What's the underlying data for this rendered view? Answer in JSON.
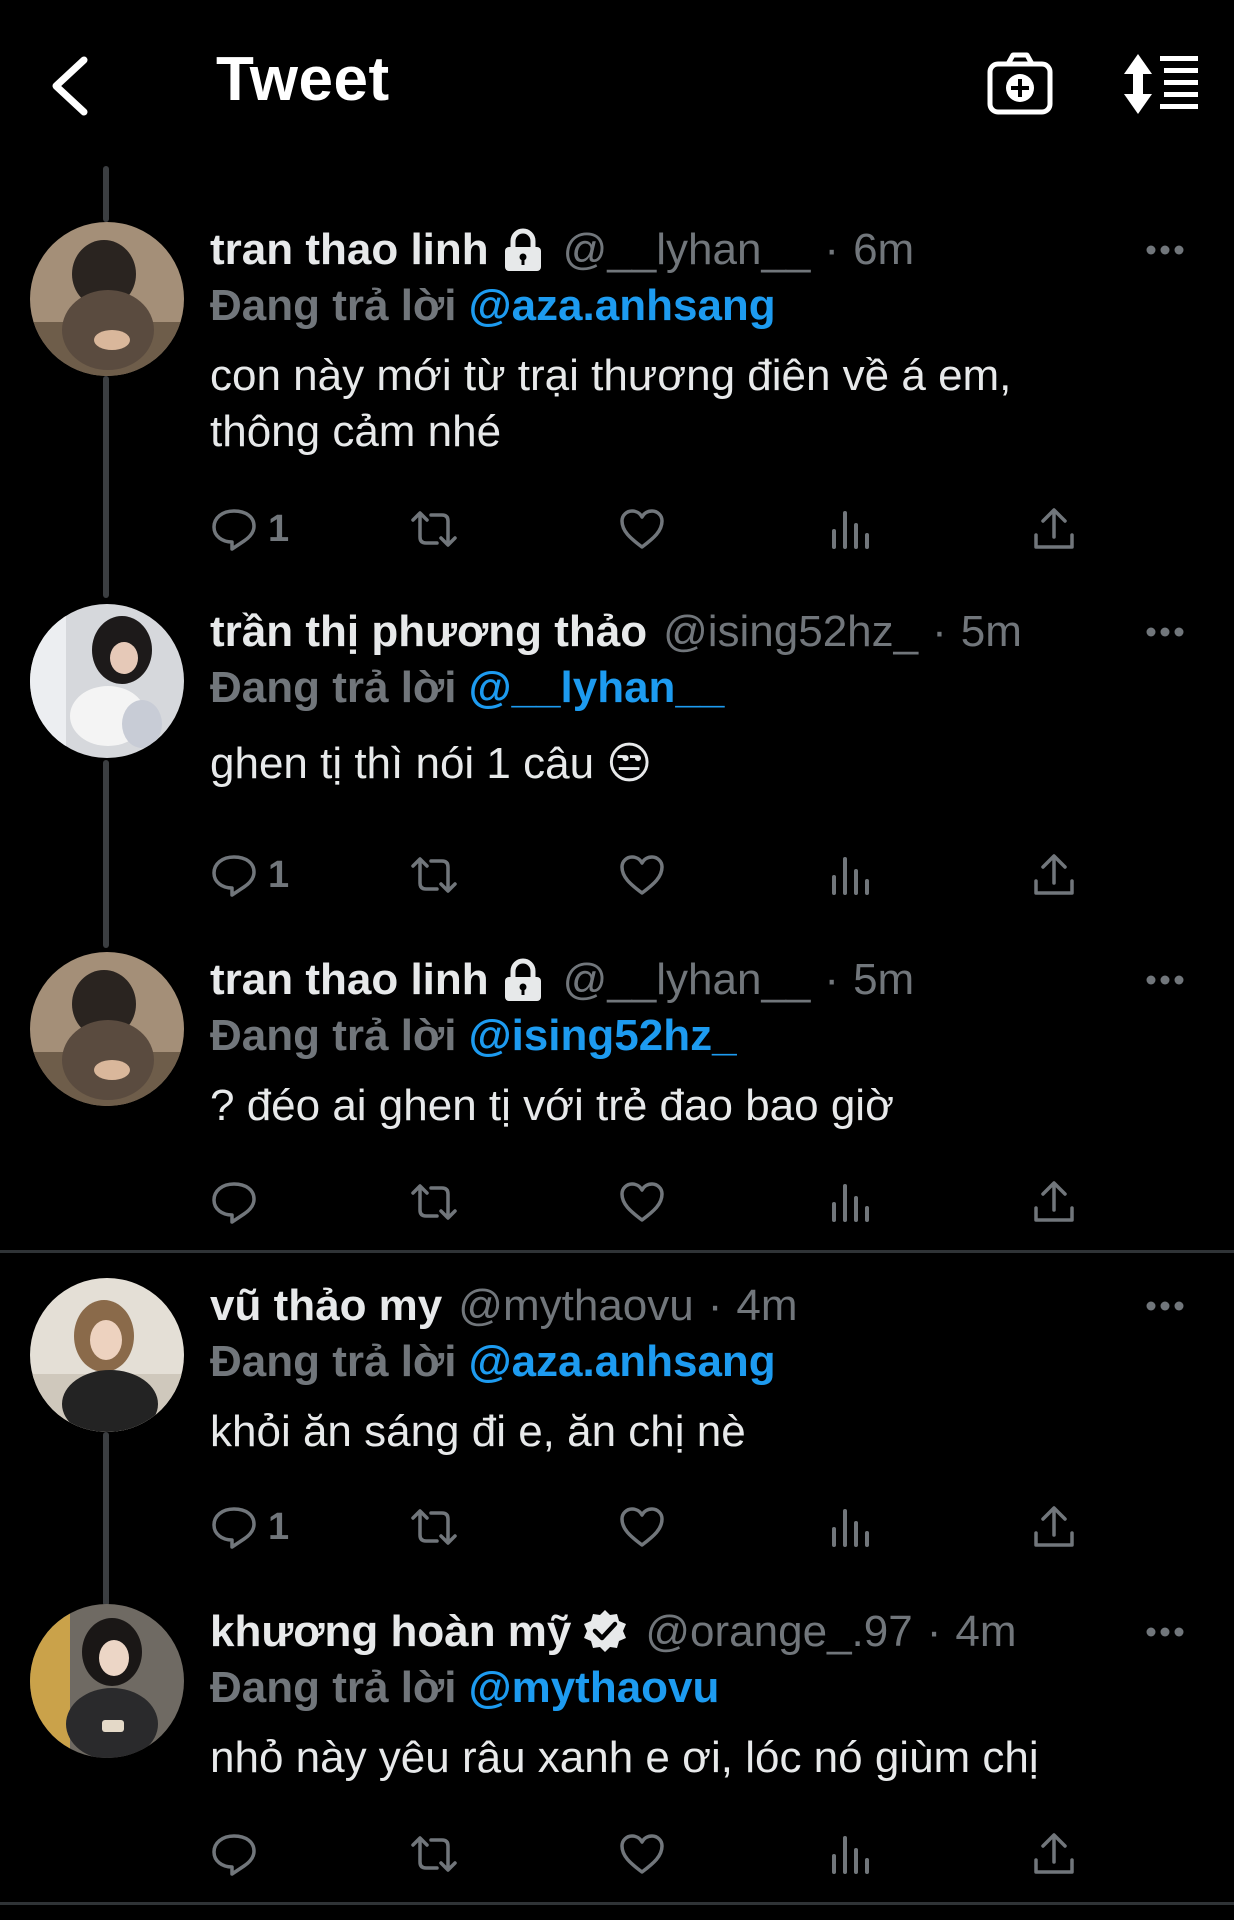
{
  "header": {
    "title": "Tweet",
    "icons": {
      "back": "chevron-left-icon",
      "camera": "camera-plus-icon",
      "sort": "sort-icon"
    }
  },
  "colors": {
    "background": "#000000",
    "text": "#e7e9ea",
    "muted": "#71767b",
    "accent": "#1d9bf0",
    "divider": "#2f3336"
  },
  "reply_prefix": "Đang trả lời",
  "tweets": [
    {
      "name": "tran thao linh",
      "badge": "lock-icon",
      "handle": "@__lyhan__",
      "time": "6m",
      "reply_to": "@aza.anhsang",
      "text": "con này mới từ trại thương điên về á em,\nthông cảm nhé",
      "reply_count": "1"
    },
    {
      "name": "trần thị phương thảo",
      "badge": "",
      "handle": "@ising52hz_",
      "time": "5m",
      "reply_to": "@__lyhan__",
      "text": "ghen tị thì nói 1 câu 😒",
      "reply_count": "1"
    },
    {
      "name": "tran thao linh",
      "badge": "lock-icon",
      "handle": "@__lyhan__",
      "time": "5m",
      "reply_to": "@ising52hz_",
      "text": "? đéo ai ghen tị với trẻ đao bao giờ",
      "reply_count": ""
    },
    {
      "name": "vũ thảo my",
      "badge": "",
      "handle": "@mythaovu",
      "time": "4m",
      "reply_to": "@aza.anhsang",
      "text": "khỏi ăn sáng đi e, ăn chị nè",
      "reply_count": "1"
    },
    {
      "name": "khương hoàn mỹ",
      "badge": "verified-badge-icon",
      "handle": "@orange_.97",
      "time": "4m",
      "reply_to": "@mythaovu",
      "text": "nhỏ này yêu râu xanh e ơi, lóc nó giùm chị",
      "reply_count": ""
    }
  ]
}
